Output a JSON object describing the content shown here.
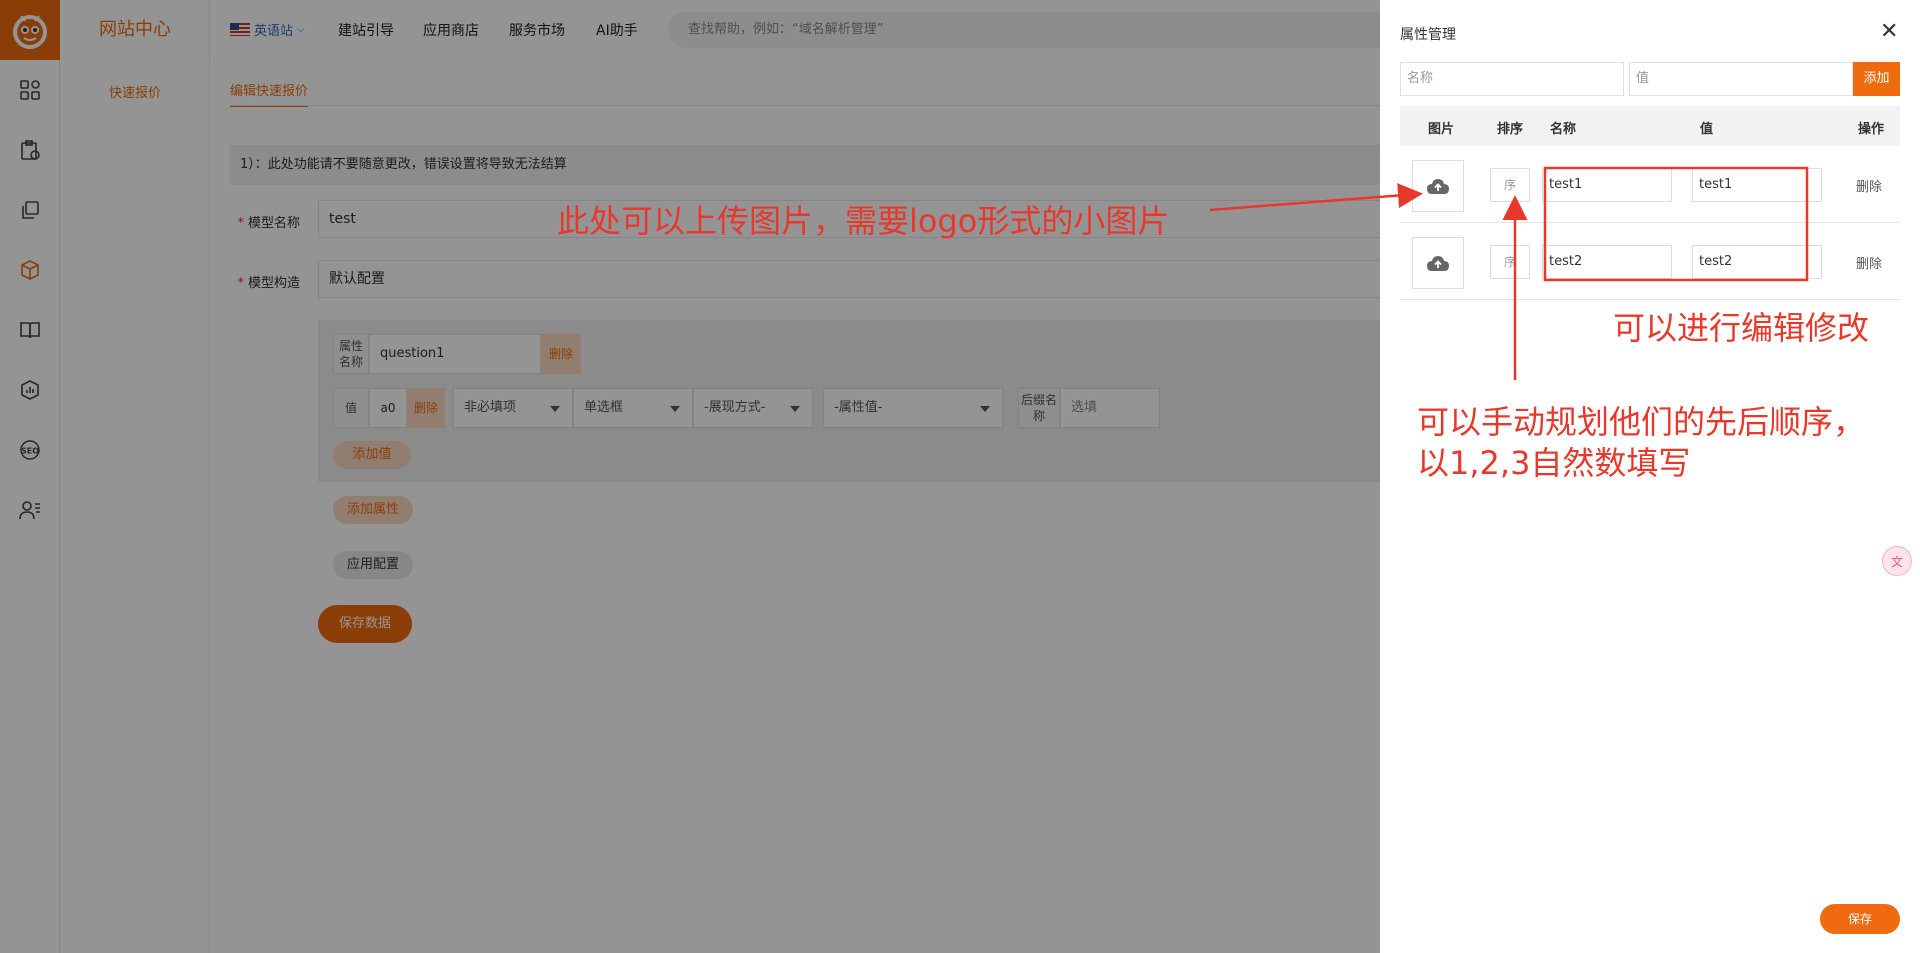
{
  "sidebar": {
    "brand": "网站中心",
    "item": "快速报价",
    "icons": [
      "dashboard-icon",
      "clipboard-icon",
      "copy-icon",
      "cube-icon",
      "book-icon",
      "chart-icon",
      "seo-icon",
      "users-icon"
    ]
  },
  "header": {
    "lang": "英语站",
    "nav": [
      "建站引导",
      "应用商店",
      "服务市场",
      "AI助手"
    ],
    "search_placeholder": "查找帮助，例如：“域名解析管理”"
  },
  "main": {
    "tab": "编辑快速报价",
    "notice": "1）：此处功能请不要随意更改，错误设置将导致无法结算",
    "model_name_label": "模型名称",
    "model_name_value": "test",
    "model_struct_label": "模型构造",
    "model_struct_value": "默认配置",
    "attr_name_label": "属性名称",
    "attr_name_value": "question1",
    "delete": "删除",
    "value_label": "值",
    "value_value": "a0",
    "select_required": "非必填项",
    "select_type": "单选框",
    "select_display": "-展现方式-",
    "select_attr": "-属性值-",
    "suffix_label": "后缀名称",
    "suffix_placeholder": "选填",
    "add_value": "添加值",
    "add_attr": "添加属性",
    "apply_config": "应用配置",
    "save_data": "保存数据"
  },
  "drawer": {
    "title": "属性管理",
    "name_placeholder": "名称",
    "value_placeholder": "值",
    "add": "添加",
    "headers": {
      "image": "图片",
      "sort": "排序",
      "name": "名称",
      "value": "值",
      "action": "操作"
    },
    "sort_placeholder": "序",
    "rows": [
      {
        "name": "test1",
        "value": "test1",
        "action": "删除"
      },
      {
        "name": "test2",
        "value": "test2",
        "action": "删除"
      }
    ],
    "save": "保存"
  },
  "annotations": {
    "upload": "此处可以上传图片，需要logo形式的小图片",
    "edit": "可以进行编辑修改",
    "sort_line1": "可以手动规划他们的先后顺序，",
    "sort_line2": "以1,2,3自然数填写"
  },
  "colors": {
    "accent": "#f06a0f",
    "annotation": "#e8382c"
  }
}
